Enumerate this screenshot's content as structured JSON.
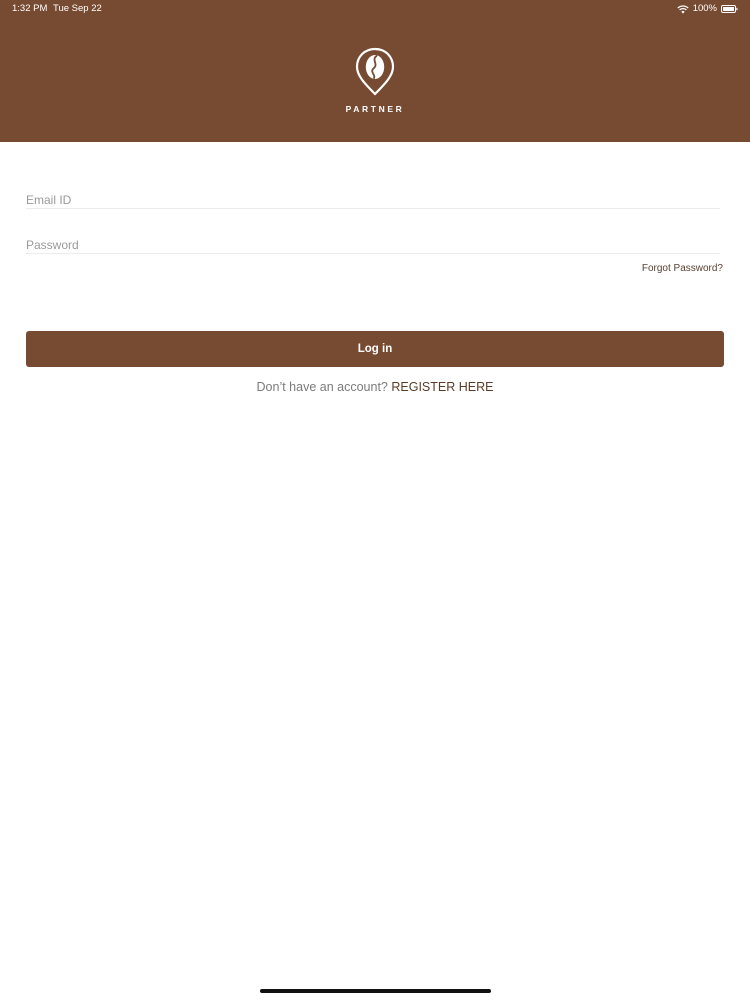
{
  "status_bar": {
    "time": "1:32 PM",
    "date": "Tue Sep 22",
    "battery": "100%",
    "icons": [
      "wifi-icon",
      "battery-icon"
    ]
  },
  "header": {
    "brand": "PARTNER",
    "logo_icon": "coffee-bean-pin-icon",
    "background_color": "#774a32"
  },
  "form": {
    "email_placeholder": "Email ID",
    "email_value": "",
    "password_placeholder": "Password",
    "password_value": "",
    "forgot_label": "Forgot Password?",
    "login_label": "Log in"
  },
  "register": {
    "prompt": "Don’t have an account?",
    "link_label": "REGISTER HERE"
  },
  "colors": {
    "accent": "#774a32",
    "link": "#5b3a26"
  }
}
